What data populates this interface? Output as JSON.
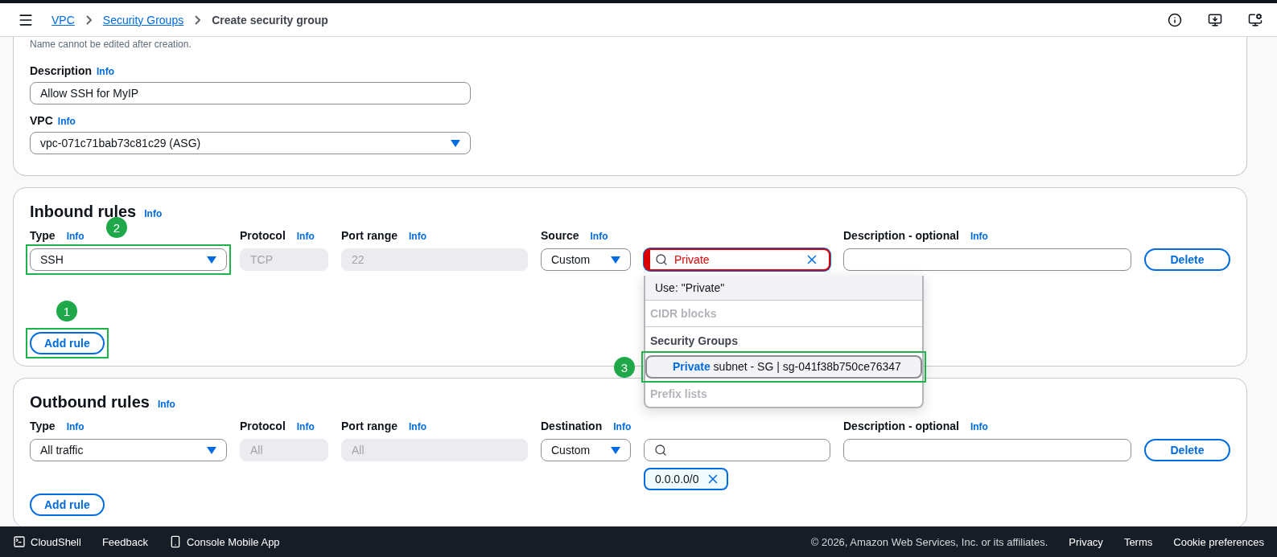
{
  "breadcrumbs": [
    {
      "label": "VPC",
      "kind": "link"
    },
    {
      "label": "Security Groups",
      "kind": "link"
    },
    {
      "label": "Create security group",
      "kind": "current"
    }
  ],
  "basic": {
    "name_hint": "Name cannot be edited after creation.",
    "fields": [
      {
        "kind": "text",
        "label": "Description",
        "info": "Info",
        "value": "Allow SSH for MyIP"
      },
      {
        "kind": "select",
        "label": "VPC",
        "info": "Info",
        "value": "vpc-071c71bab73c81c29 (ASG)"
      }
    ]
  },
  "inbound": {
    "title": "Inbound rules",
    "info": "Info",
    "columns": [
      {
        "label": "Type",
        "info": "Info"
      },
      {
        "label": "Protocol",
        "info": "Info"
      },
      {
        "label": "Port range",
        "info": "Info"
      },
      {
        "label": "Source",
        "info": "Info"
      },
      {
        "label": "Description - optional",
        "info": "Info"
      }
    ],
    "rows": [
      {
        "type": "SSH",
        "type_highlight": {
          "number": "2"
        },
        "protocol": "TCP",
        "port_range": "22",
        "source": "Custom",
        "search": {
          "value": "Private",
          "invalid": true
        },
        "delete": "Delete",
        "dropdown": [
          {
            "kind": "option",
            "text": "Use: \"Private\""
          },
          {
            "kind": "group",
            "text": "CIDR blocks",
            "disabled": true
          },
          {
            "kind": "group",
            "text": "Security Groups",
            "disabled": false
          },
          {
            "kind": "match",
            "text": "**Private** subnet - SG | sg-041f38b750ce76347",
            "selected": true,
            "highlight": {
              "number": "3"
            }
          },
          {
            "kind": "group",
            "text": "Prefix lists",
            "disabled": true
          }
        ]
      }
    ],
    "add_rule": {
      "label": "Add rule",
      "highlight": {
        "number": "1"
      }
    }
  },
  "outbound": {
    "title": "Outbound rules",
    "info": "Info",
    "columns": [
      {
        "label": "Type",
        "info": "Info"
      },
      {
        "label": "Protocol",
        "info": "Info"
      },
      {
        "label": "Port range",
        "info": "Info"
      },
      {
        "label": "Destination",
        "info": "Info"
      },
      {
        "label": "Description - optional",
        "info": "Info"
      }
    ],
    "rows": [
      {
        "type": "All traffic",
        "protocol": "All",
        "port_range": "All",
        "source": "Custom",
        "search": {
          "invalid": false
        },
        "chips": [
          "0.0.0.0/0"
        ],
        "delete": "Delete"
      }
    ],
    "add_rule": {
      "label": "Add rule"
    }
  },
  "footer": {
    "left": [
      {
        "label": "CloudShell",
        "kind": "terminal"
      },
      {
        "label": "Feedback",
        "kind": "plain"
      },
      {
        "label": "Console Mobile App",
        "kind": "phone"
      }
    ],
    "copyright": "© 2026, Amazon Web Services, Inc. or its affiliates.",
    "links": [
      "Privacy",
      "Terms",
      "Cookie preferences"
    ]
  }
}
